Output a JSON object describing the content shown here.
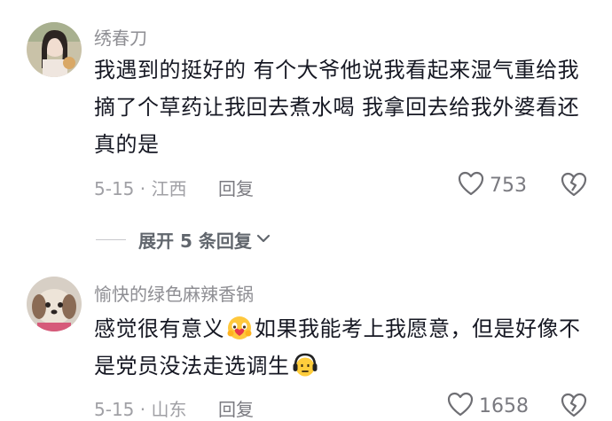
{
  "comments": [
    {
      "username": "绣春刀",
      "text": "我遇到的挺好的  有个大爷他说我看起来湿气重给我摘了个草药让我回去煮水喝  我拿回去给我外婆看还真的是",
      "date_location": "5-15 · 江西",
      "reply_label": "回复",
      "likes": "753"
    },
    {
      "username": "愉快的绿色麻辣香锅",
      "text_a": "感觉很有意义",
      "text_b": "如果我能考上我愿意，但是好像不是党员没法走选调生",
      "date_location": "5-15 · 山东",
      "reply_label": "回复",
      "likes": "1658"
    }
  ],
  "expand_replies": "展开 5 条回复",
  "icons": {
    "like": "heart-outline-icon",
    "dislike": "broken-heart-icon",
    "expand": "chevron-down-icon",
    "emoji_1": "touched-face-emoji-icon",
    "emoji_2": "headphones-face-emoji-icon"
  }
}
